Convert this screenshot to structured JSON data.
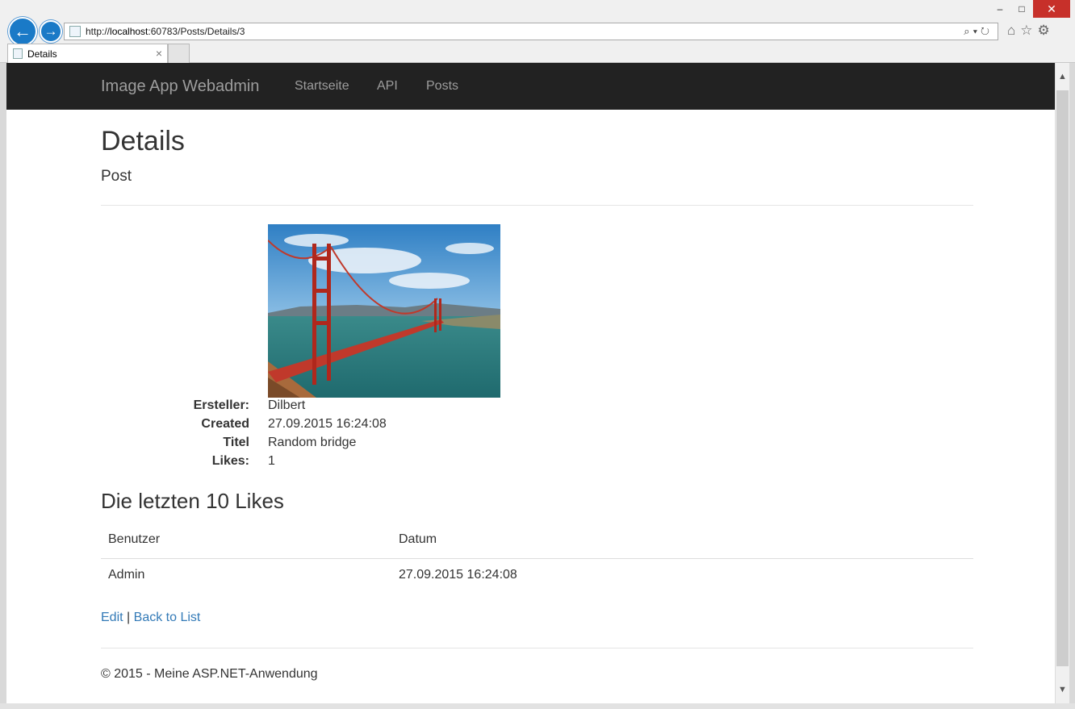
{
  "browser": {
    "url_prefix": "http://",
    "url_host": "localhost",
    "url_rest": ":60783/Posts/Details/3",
    "tab_title": "Details",
    "tab_close": "×",
    "minimize": "‒",
    "maximize": "□",
    "close": "✕",
    "back": "←",
    "forward": "→",
    "addr_tools": "⌕▾↻",
    "right_icons": "⌂☆⚙",
    "scroll_up": "▲",
    "scroll_down": "▼"
  },
  "navbar": {
    "brand": "Image App Webadmin",
    "links": [
      "Startseite",
      "API",
      "Posts"
    ]
  },
  "page": {
    "title": "Details",
    "subtitle": "Post"
  },
  "details": [
    {
      "label": "Ersteller:",
      "value": "Dilbert"
    },
    {
      "label": "Created",
      "value": "27.09.2015 16:24:08"
    },
    {
      "label": "Titel",
      "value": "Random bridge"
    },
    {
      "label": "Likes:",
      "value": "1"
    }
  ],
  "likes": {
    "heading": "Die letzten 10 Likes",
    "columns": [
      "Benutzer",
      "Datum"
    ],
    "rows": [
      [
        "Admin",
        "27.09.2015 16:24:08"
      ]
    ]
  },
  "actions": {
    "edit": "Edit",
    "separator": "|",
    "back": "Back to List"
  },
  "footer": {
    "text": "© 2015 - Meine ASP.NET-Anwendung"
  },
  "colors": {
    "navbar_bg": "#222222",
    "link": "#337ab7",
    "browser_close": "#c7302a",
    "browser_accent": "#1a7ac7"
  }
}
